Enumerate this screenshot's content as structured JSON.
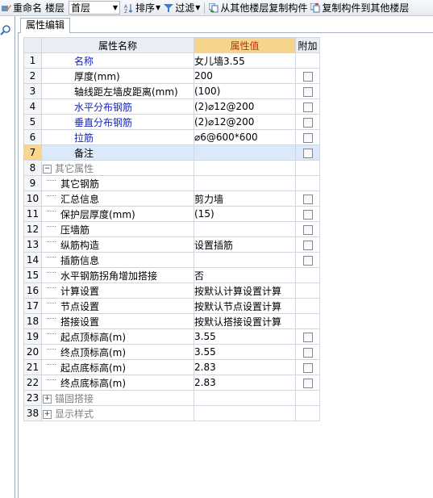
{
  "toolbar": {
    "rename_label": "重命名",
    "floor_label": "楼层",
    "floor_value": "首层",
    "sort_label": "排序",
    "filter_label": "过滤",
    "copy_from_label": "从其他楼层复制构件",
    "copy_to_label": "复制构件到其他楼层"
  },
  "tab": {
    "title": "属性编辑"
  },
  "grid": {
    "headers": {
      "name": "属性名称",
      "value": "属性值",
      "extra": "附加"
    },
    "rows": [
      {
        "num": "1",
        "name": "名称",
        "value": "女儿墙3.55",
        "style": "blue",
        "indent": 0,
        "checkbox": false
      },
      {
        "num": "2",
        "name": "厚度(mm)",
        "value": "200",
        "style": "normal",
        "indent": 0,
        "checkbox": true
      },
      {
        "num": "3",
        "name": "轴线距左墙皮距离(mm)",
        "value": "(100)",
        "style": "normal",
        "indent": 0,
        "checkbox": true
      },
      {
        "num": "4",
        "name": "水平分布钢筋",
        "value": "(2)⌀12@200",
        "style": "blue",
        "indent": 0,
        "checkbox": true
      },
      {
        "num": "5",
        "name": "垂直分布钢筋",
        "value": "(2)⌀12@200",
        "style": "blue",
        "indent": 0,
        "checkbox": true
      },
      {
        "num": "6",
        "name": "拉筋",
        "value": "⌀6@600*600",
        "style": "blue",
        "indent": 0,
        "checkbox": true
      },
      {
        "num": "7",
        "name": "备注",
        "value": "",
        "style": "normal",
        "indent": 0,
        "checkbox": true,
        "selected": true
      },
      {
        "num": "8",
        "name": "其它属性",
        "value": "",
        "style": "gray",
        "indent": 0,
        "checkbox": false,
        "group": "minus"
      },
      {
        "num": "9",
        "name": "其它钢筋",
        "value": "",
        "style": "normal",
        "indent": 1,
        "checkbox": false
      },
      {
        "num": "10",
        "name": "汇总信息",
        "value": "剪力墙",
        "style": "normal",
        "indent": 1,
        "checkbox": true
      },
      {
        "num": "11",
        "name": "保护层厚度(mm)",
        "value": "(15)",
        "style": "normal",
        "indent": 1,
        "checkbox": true
      },
      {
        "num": "12",
        "name": "压墙筋",
        "value": "",
        "style": "normal",
        "indent": 1,
        "checkbox": true
      },
      {
        "num": "13",
        "name": "纵筋构造",
        "value": "设置插筋",
        "style": "normal",
        "indent": 1,
        "checkbox": true
      },
      {
        "num": "14",
        "name": "插筋信息",
        "value": "",
        "style": "normal",
        "indent": 1,
        "checkbox": true
      },
      {
        "num": "15",
        "name": "水平钢筋拐角增加搭接",
        "value": "否",
        "style": "normal",
        "indent": 1,
        "checkbox": false
      },
      {
        "num": "16",
        "name": "计算设置",
        "value": "按默认计算设置计算",
        "style": "normal",
        "indent": 1,
        "checkbox": false
      },
      {
        "num": "17",
        "name": "节点设置",
        "value": "按默认节点设置计算",
        "style": "normal",
        "indent": 1,
        "checkbox": false
      },
      {
        "num": "18",
        "name": "搭接设置",
        "value": "按默认搭接设置计算",
        "style": "normal",
        "indent": 1,
        "checkbox": false
      },
      {
        "num": "19",
        "name": "起点顶标高(m)",
        "value": "3.55",
        "style": "normal",
        "indent": 1,
        "checkbox": true
      },
      {
        "num": "20",
        "name": "终点顶标高(m)",
        "value": "3.55",
        "style": "normal",
        "indent": 1,
        "checkbox": true
      },
      {
        "num": "21",
        "name": "起点底标高(m)",
        "value": "2.83",
        "style": "normal",
        "indent": 1,
        "checkbox": true
      },
      {
        "num": "22",
        "name": "终点底标高(m)",
        "value": "2.83",
        "style": "normal",
        "indent": 1,
        "checkbox": true
      },
      {
        "num": "23",
        "name": "锚固搭接",
        "value": "",
        "style": "gray",
        "indent": 0,
        "checkbox": false,
        "group": "plus"
      },
      {
        "num": "38",
        "name": "显示样式",
        "value": "",
        "style": "gray",
        "indent": 0,
        "checkbox": false,
        "group": "plus"
      }
    ]
  },
  "colors": {
    "header_value_bg": "#f6d48b",
    "header_value_text": "#c0320a",
    "link_blue": "#1525b8",
    "group_gray": "#808080",
    "selected_row": "#dbe9fb"
  }
}
